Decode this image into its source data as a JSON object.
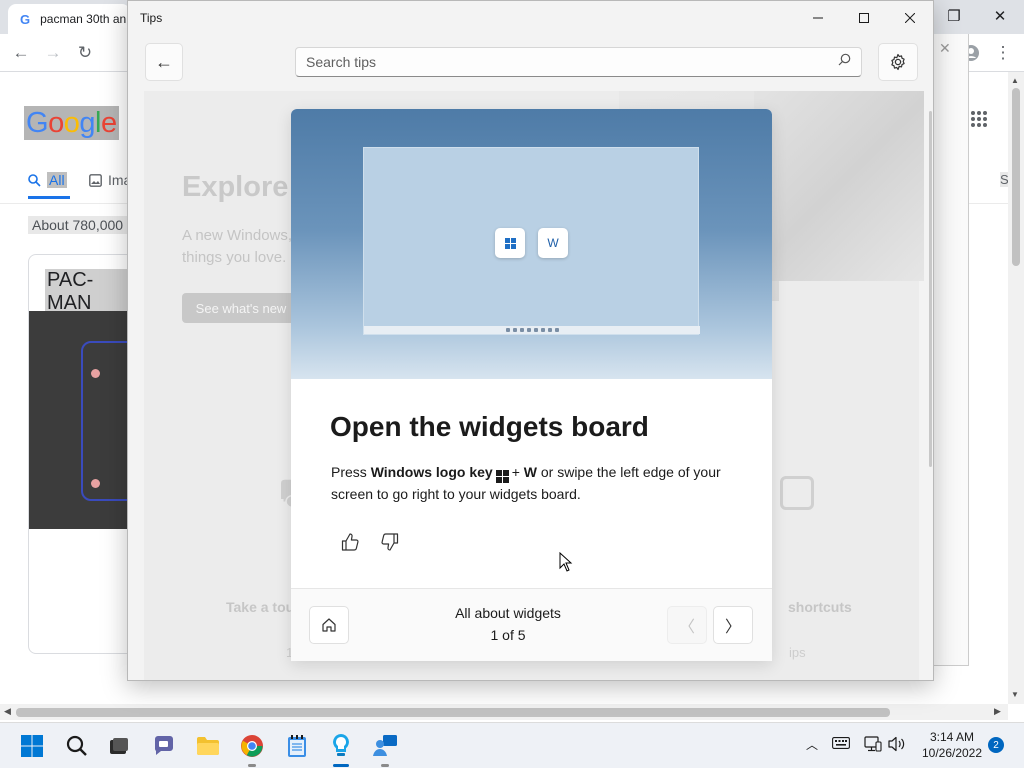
{
  "browser": {
    "tab_title": "pacman 30th an",
    "tab_favicon": "G",
    "google_logo": "Google",
    "tabs": {
      "all": "All",
      "images": "Ima"
    },
    "results_text": "About 780,000",
    "card_title": "PAC-MAN",
    "side_label": "S"
  },
  "tips_window": {
    "title": "Tips",
    "search_placeholder": "Search tips",
    "background": {
      "title": "Explore W",
      "subtitle": "A new Windows, things you love.",
      "button": "See what's new",
      "tile_left": "Take a tour",
      "tile_right": "shortcuts",
      "tile_left_sub": "10",
      "tile_right_sub": "ips"
    },
    "card": {
      "title": "Open the widgets board",
      "text_press": "Press",
      "text_key": "Windows logo key",
      "text_plus": "+",
      "text_w": "W",
      "text_rest": "or swipe the left edge of your screen to go right to your widgets board.",
      "hero_key_w": "W",
      "footer_title": "All about widgets",
      "footer_count": "1 of 5"
    }
  },
  "taskbar": {
    "time": "3:14 AM",
    "date": "10/26/2022",
    "notification_count": "2"
  },
  "colors": {
    "accent": "#0067c0",
    "hero_top": "#4e7ba7",
    "hero_bottom": "#d7e4ef"
  }
}
